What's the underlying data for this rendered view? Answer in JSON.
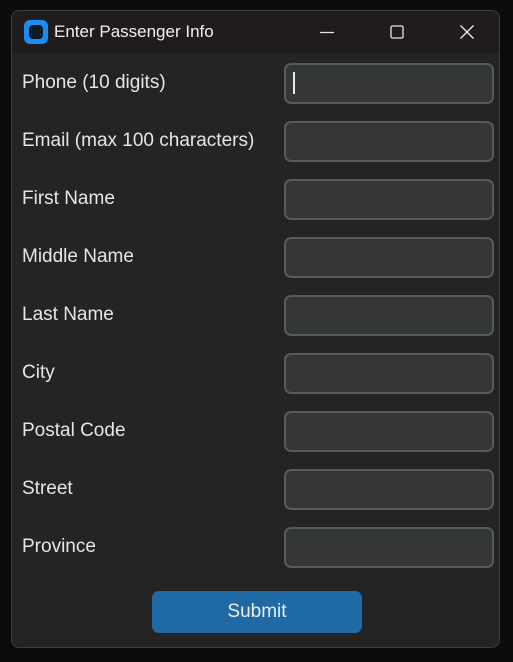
{
  "window": {
    "title": "Enter Passenger Info",
    "icon": "app-logo-icon",
    "controls": [
      "minimize-icon",
      "maximize-icon",
      "close-icon"
    ]
  },
  "form": {
    "fields": [
      {
        "label": "Phone (10 digits)",
        "value": "",
        "focused": true
      },
      {
        "label": "Email (max 100 characters)",
        "value": ""
      },
      {
        "label": "First Name",
        "value": ""
      },
      {
        "label": "Middle Name",
        "value": ""
      },
      {
        "label": "Last Name",
        "value": ""
      },
      {
        "label": "City",
        "value": ""
      },
      {
        "label": "Postal Code",
        "value": ""
      },
      {
        "label": "Street",
        "value": ""
      },
      {
        "label": "Province",
        "value": ""
      }
    ],
    "submit_label": "Submit"
  },
  "colors": {
    "window_bg": "#242424",
    "input_bg": "#343638",
    "input_border": "#565b5e",
    "accent": "#1f6aa5",
    "icon_blue": "#1a8cf0"
  }
}
